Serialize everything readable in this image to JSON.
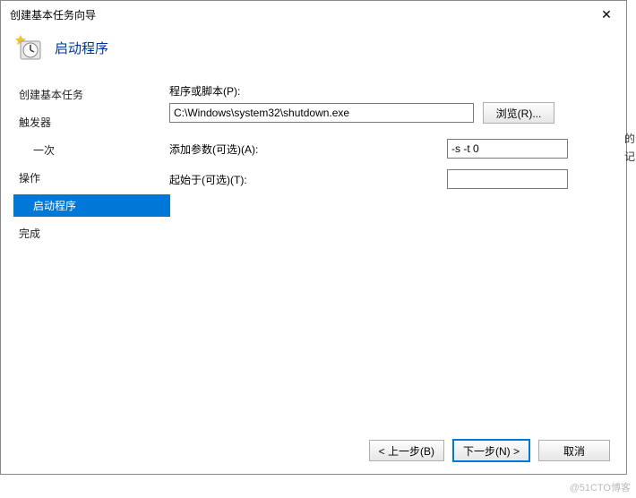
{
  "window": {
    "title": "创建基本任务向导",
    "close_label": "✕"
  },
  "header": {
    "icon": "clock-wizard-icon",
    "page_title": "启动程序"
  },
  "sidebar": {
    "items": [
      {
        "label": "创建基本任务",
        "type": "top"
      },
      {
        "label": "触发器",
        "type": "top"
      },
      {
        "label": "一次",
        "type": "sub"
      },
      {
        "label": "操作",
        "type": "top"
      },
      {
        "label": "启动程序",
        "type": "sub-selected"
      },
      {
        "label": "完成",
        "type": "top"
      }
    ]
  },
  "form": {
    "program_label": "程序或脚本(P):",
    "program_value": "C:\\Windows\\system32\\shutdown.exe",
    "browse_label": "浏览(R)...",
    "args_label": "添加参数(可选)(A):",
    "args_value": "-s -t 0",
    "startin_label": "起始于(可选)(T):",
    "startin_value": ""
  },
  "buttons": {
    "back": "< 上一步(B)",
    "next": "下一步(N) >",
    "cancel": "取消"
  },
  "edge_hints": {
    "line1": "的",
    "line2": "记"
  },
  "watermark": "@51CTO博客"
}
